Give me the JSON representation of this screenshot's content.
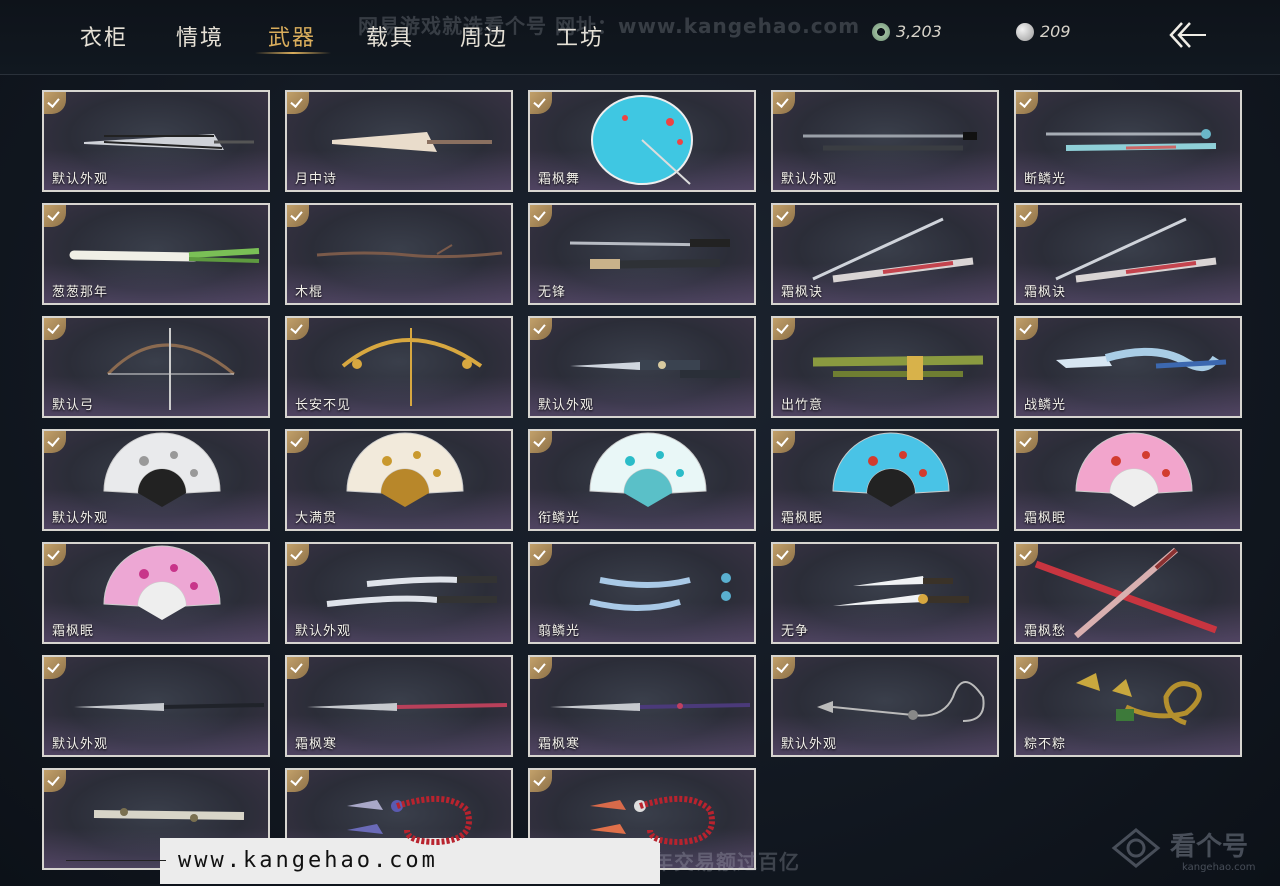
{
  "tabs": [
    {
      "label": "衣柜",
      "active": false
    },
    {
      "label": "情境",
      "active": false
    },
    {
      "label": "武器",
      "active": true
    },
    {
      "label": "载具",
      "active": false
    },
    {
      "label": "周边",
      "active": false
    },
    {
      "label": "工坊",
      "active": false
    }
  ],
  "watermark_top": "网易游戏就选看个号  网址：www.kangehao.com",
  "currency": {
    "jade": {
      "value": "3,203",
      "icon": "jade-coin-icon"
    },
    "silver": {
      "value": "209",
      "icon": "silver-coin-icon"
    }
  },
  "items": [
    {
      "label": "默认外观",
      "art": "umbrella-dark",
      "owned": true
    },
    {
      "label": "月中诗",
      "art": "umbrella-cream",
      "owned": true
    },
    {
      "label": "霜枫舞",
      "art": "umbrella-open-blue",
      "owned": true
    },
    {
      "label": "默认外观",
      "art": "sword-pair-dark",
      "owned": true
    },
    {
      "label": "断鳞光",
      "art": "sword-pair-jade",
      "owned": true
    },
    {
      "label": "葱葱那年",
      "art": "scallion",
      "owned": true
    },
    {
      "label": "木棍",
      "art": "wood-stick",
      "owned": true
    },
    {
      "label": "无锋",
      "art": "sword-pair-ornate",
      "owned": true
    },
    {
      "label": "霜枫诀",
      "art": "katana-red",
      "owned": true
    },
    {
      "label": "霜枫诀",
      "art": "katana-red",
      "owned": true
    },
    {
      "label": "默认弓",
      "art": "bow-plain",
      "owned": true
    },
    {
      "label": "长安不见",
      "art": "bow-gold",
      "owned": true
    },
    {
      "label": "默认外观",
      "art": "dagger-pair",
      "owned": true
    },
    {
      "label": "出竹意",
      "art": "bamboo",
      "owned": true
    },
    {
      "label": "战鳞光",
      "art": "spear-dragon",
      "owned": true
    },
    {
      "label": "默认外观",
      "art": "fan-white",
      "owned": true
    },
    {
      "label": "大满贯",
      "art": "fan-gold",
      "owned": true
    },
    {
      "label": "衔鳞光",
      "art": "fan-teal",
      "owned": true
    },
    {
      "label": "霜枫眠",
      "art": "fan-blue-red",
      "owned": true
    },
    {
      "label": "霜枫眠",
      "art": "fan-pink-red",
      "owned": true
    },
    {
      "label": "霜枫眠",
      "art": "fan-magenta",
      "owned": true
    },
    {
      "label": "默认外观",
      "art": "dual-blades",
      "owned": true
    },
    {
      "label": "翦鳞光",
      "art": "dual-blades-blue",
      "owned": true
    },
    {
      "label": "无争",
      "art": "dual-blades-gold",
      "owned": true
    },
    {
      "label": "霜枫愁",
      "art": "crossed-spears-red",
      "owned": true
    },
    {
      "label": "默认外观",
      "art": "glaive-dark",
      "owned": true
    },
    {
      "label": "霜枫寒",
      "art": "glaive-red",
      "owned": true
    },
    {
      "label": "霜枫寒",
      "art": "glaive-purple",
      "owned": true
    },
    {
      "label": "默认外观",
      "art": "rope-dart",
      "owned": true
    },
    {
      "label": "粽不粽",
      "art": "rope-dart-gold",
      "owned": true
    },
    {
      "label": "",
      "art": "spiked-club",
      "owned": true
    },
    {
      "label": "",
      "art": "beads-blue",
      "owned": true
    },
    {
      "label": "",
      "art": "beads-red",
      "owned": true
    }
  ],
  "bottom": {
    "url": "www.kangehao.com",
    "slogan": "看个号专业网易游戏八年  年交易额过百亿",
    "logo_text": "看个号",
    "logo_sub": "kangehao.com"
  }
}
